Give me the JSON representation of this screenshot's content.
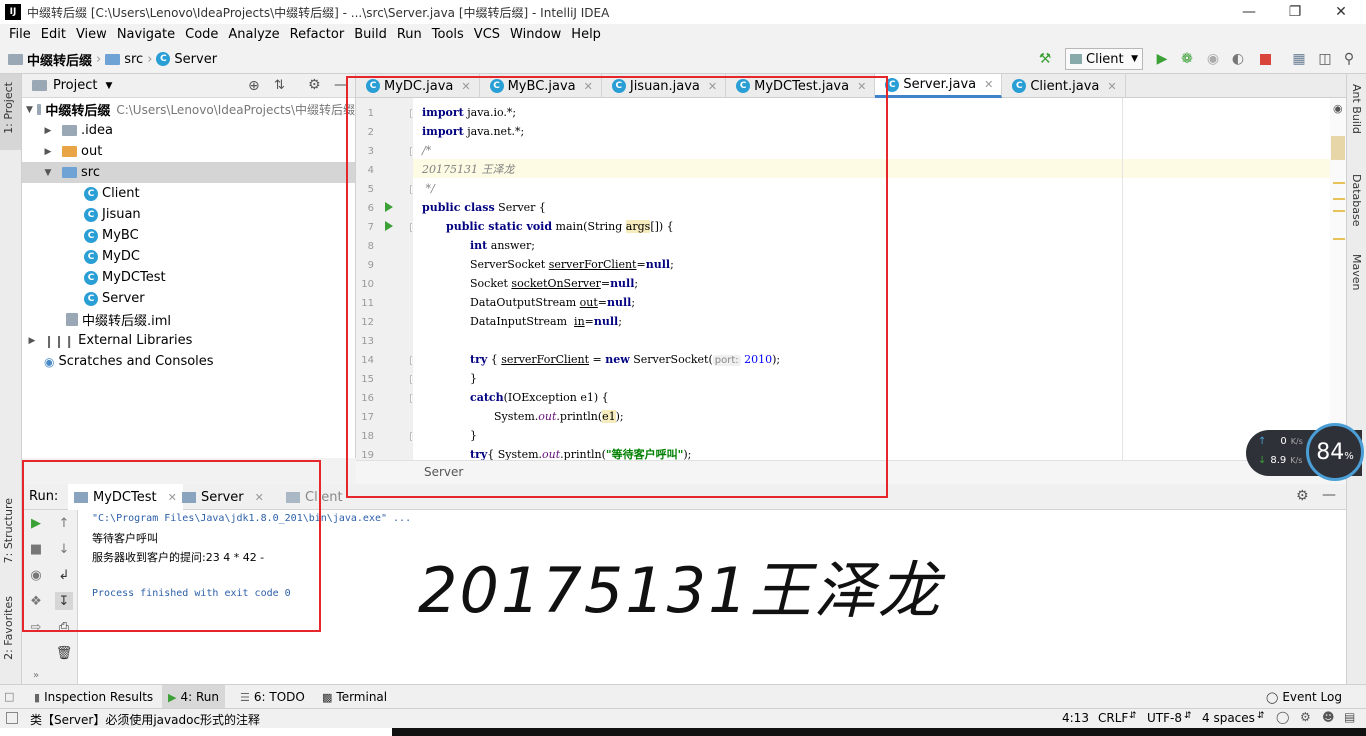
{
  "window": {
    "title": "中缀转后缀 [C:\\Users\\Lenovo\\IdeaProjects\\中缀转后缀] - ...\\src\\Server.java [中缀转后缀] - IntelliJ IDEA",
    "app_icon": "IJ"
  },
  "menu": [
    "File",
    "Edit",
    "View",
    "Navigate",
    "Code",
    "Analyze",
    "Refactor",
    "Build",
    "Run",
    "Tools",
    "VCS",
    "Window",
    "Help"
  ],
  "breadcrumbs": [
    "中缀转后缀",
    "src",
    "Server"
  ],
  "toolbar": {
    "run_config": "Client"
  },
  "left_strip": {
    "project_tab": "1: Project",
    "structure_tab": "7: Structure",
    "favorites_tab": "2: Favorites"
  },
  "right_strip": {
    "ant": "Ant Build",
    "database": "Database",
    "maven": "Maven"
  },
  "project": {
    "header": "Project",
    "root_label": "中缀转后缀",
    "root_path": "C:\\Users\\Lenovo\\IdeaProjects\\中缀转后缀",
    "items": [
      ".idea",
      "out",
      "src",
      "Client",
      "Jisuan",
      "MyBC",
      "MyDC",
      "MyDCTest",
      "Server",
      "中缀转后缀.iml",
      "External Libraries",
      "Scratches and Consoles"
    ]
  },
  "editor": {
    "tabs": [
      "MyDC.java",
      "MyBC.java",
      "Jisuan.java",
      "MyDCTest.java",
      "Server.java",
      "Client.java"
    ],
    "active_tab": "Server.java",
    "line_numbers": [
      "1",
      "2",
      "3",
      "4",
      "5",
      "6",
      "7",
      "8",
      "9",
      "10",
      "11",
      "12",
      "13",
      "14",
      "15",
      "16",
      "17",
      "18",
      "19"
    ],
    "breadcrumb": "Server",
    "code": {
      "l1_kw": "import",
      "l1_rest": " java.io.*;",
      "l2_kw": "import",
      "l2_rest": " java.net.*;",
      "l3": "/*",
      "l4": "20175131 王泽龙",
      "l5": " */",
      "l6_kw": "public class",
      "l6_rest": " Server {",
      "l7_kw": "public static void",
      "l7_a": " main(String ",
      "l7_args": "args",
      "l7_b": "[]) {",
      "l8_kw": "int",
      "l8_rest": " answer;",
      "l9_a": "ServerSocket ",
      "l9_var": "serverForClient",
      "l9_b": "=",
      "l9_null": "null",
      "l9_c": ";",
      "l10_a": "Socket ",
      "l10_var": "socketOnServer",
      "l10_b": "=",
      "l10_null": "null",
      "l10_c": ";",
      "l11_a": "DataOutputStream ",
      "l11_var": "out",
      "l11_b": "=",
      "l11_null": "null",
      "l11_c": ";",
      "l12_a": "DataInputStream  ",
      "l12_var": "in",
      "l12_b": "=",
      "l12_null": "null",
      "l12_c": ";",
      "l14_kw": "try",
      "l14_a": " { ",
      "l14_var": "serverForClient",
      "l14_b": " = ",
      "l14_new": "new",
      "l14_c": " ServerSocket(",
      "l14_hint": "port:",
      "l14_num": " 2010",
      "l14_d": ");",
      "l15": "}",
      "l16_kw": "catch",
      "l16_rest": "(IOException e1) {",
      "l17_a": "System.",
      "l17_out": "out",
      "l17_b": ".println(",
      "l17_e1": "e1",
      "l17_c": ");",
      "l18": "}",
      "l19_kw": "try",
      "l19_a": "{ System.",
      "l19_out": "out",
      "l19_b": ".println(",
      "l19_str": "\"等待客户呼叫\"",
      "l19_c": ");"
    }
  },
  "run": {
    "label": "Run:",
    "tabs": [
      "MyDCTest",
      "Server",
      "Client"
    ],
    "console": [
      "\"C:\\Program Files\\Java\\jdk1.8.0_201\\bin\\java.exe\" ...",
      "等待客户呼叫",
      "服务器收到客户的提问:23 4 * 42 -",
      "",
      "Process finished with exit code 0"
    ]
  },
  "overlay_text": "20175131王泽龙",
  "bottom_tabs": [
    "Inspection Results",
    "4: Run",
    "6: TODO",
    "Terminal",
    "Event Log"
  ],
  "status": {
    "message": "类【Server】必须使用javadoc形式的注释",
    "position": "4:13",
    "line_sep": "CRLF",
    "encoding": "UTF-8",
    "indent": "4 spaces"
  },
  "net_widget": {
    "up": "0",
    "up_unit": "K/s",
    "down": "8.9",
    "down_unit": "K/s",
    "percent": "84",
    "percent_sign": "%"
  },
  "colors": {
    "annotation": "#e5262b",
    "accent": "#4083c9",
    "run_green": "#3ba035"
  }
}
